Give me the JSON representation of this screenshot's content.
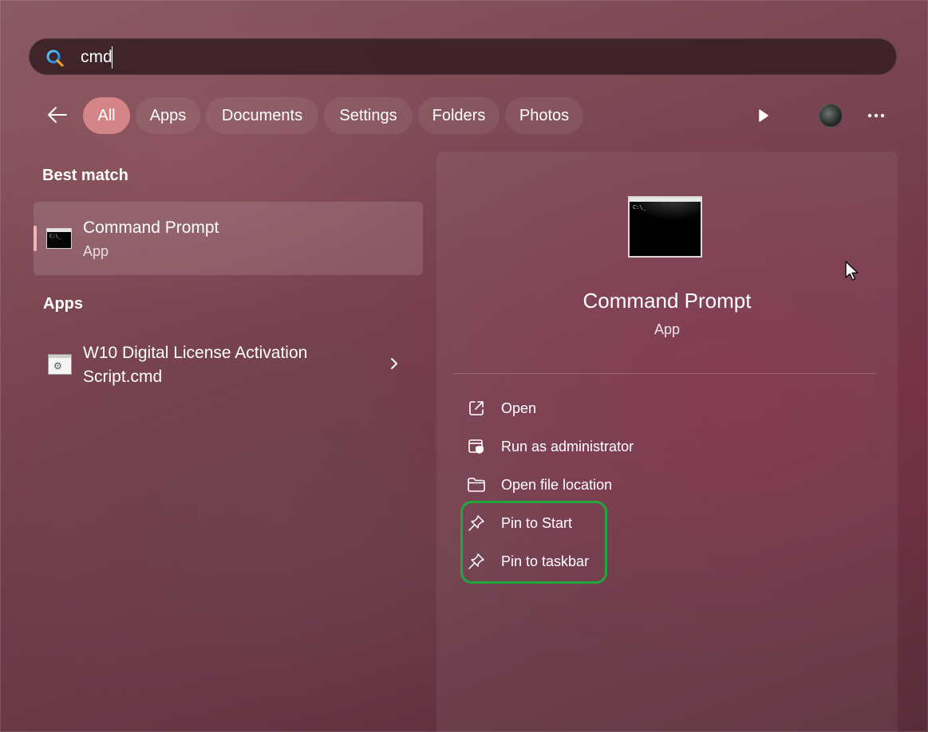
{
  "search": {
    "query": "cmd"
  },
  "filters": [
    {
      "label": "All",
      "active": true
    },
    {
      "label": "Apps",
      "active": false
    },
    {
      "label": "Documents",
      "active": false
    },
    {
      "label": "Settings",
      "active": false
    },
    {
      "label": "Folders",
      "active": false
    },
    {
      "label": "Photos",
      "active": false
    }
  ],
  "best_match": {
    "heading": "Best match",
    "title": "Command Prompt",
    "subtitle": "App",
    "icon": "cmd-icon"
  },
  "apps_section": {
    "heading": "Apps",
    "items": [
      {
        "title_line1": "W10 Digital License Activation",
        "title_line2": "Script.cmd",
        "icon": "script-icon"
      }
    ]
  },
  "details": {
    "title": "Command Prompt",
    "subtitle": "App",
    "icon_prompt": "C:\\_",
    "actions": [
      {
        "label": "Open",
        "icon": "open-external-icon"
      },
      {
        "label": "Run as administrator",
        "icon": "shield-window-icon"
      },
      {
        "label": "Open file location",
        "icon": "folder-icon"
      },
      {
        "label": "Pin to Start",
        "icon": "pin-icon"
      },
      {
        "label": "Pin to taskbar",
        "icon": "pin-icon"
      }
    ]
  },
  "colors": {
    "active_filter": "#ec9696",
    "highlight_box": "#1fa83c",
    "accent_bar": "#f2b5b5"
  }
}
